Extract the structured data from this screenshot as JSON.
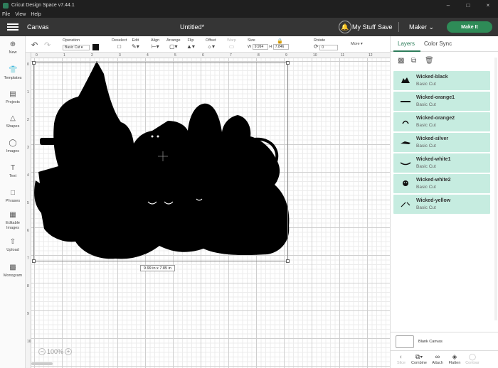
{
  "window": {
    "title": "Cricut Design Space  v7.44.1"
  },
  "menu": [
    "File",
    "View",
    "Help"
  ],
  "header": {
    "section": "Canvas",
    "doc_title": "Untitled*",
    "my_stuff": "My Stuff",
    "save": "Save",
    "machine": "Maker",
    "make_it": "Make It"
  },
  "left_tools": [
    {
      "label": "New",
      "icon": "plus-icon"
    },
    {
      "label": "Templates",
      "icon": "shirt-icon"
    },
    {
      "label": "Projects",
      "icon": "projects-icon"
    },
    {
      "label": "Shapes",
      "icon": "shapes-icon"
    },
    {
      "label": "Images",
      "icon": "bulb-icon"
    },
    {
      "label": "Text",
      "icon": "text-icon"
    },
    {
      "label": "Phrases",
      "icon": "chat-icon"
    },
    {
      "label": "Editable Images",
      "icon": "editable-images-icon"
    },
    {
      "label": "Upload",
      "icon": "upload-icon"
    },
    {
      "label": "Monogram",
      "icon": "monogram-icon"
    }
  ],
  "edit_toolbar": {
    "operation_label": "Operation",
    "operation_value": "Basic Cut",
    "deselect": "Deselect",
    "edit": "Edit",
    "align": "Align",
    "arrange": "Arrange",
    "flip": "Flip",
    "offset": "Offset",
    "warp": "Warp",
    "size_label": "Size",
    "w_label": "W",
    "w_value": "9.994",
    "h_label": "H",
    "h_value": "7.846",
    "rotate_label": "Rotate",
    "rotate_value": "0",
    "more": "More"
  },
  "canvas": {
    "ruler_top": [
      "0",
      "1",
      "2",
      "3",
      "4",
      "5",
      "6",
      "7",
      "8",
      "9",
      "10",
      "11",
      "12"
    ],
    "ruler_left": [
      "0",
      "1",
      "2",
      "3",
      "4",
      "5",
      "6",
      "7",
      "8",
      "9",
      "10"
    ],
    "size_readout": "9.99  in x 7.85  in",
    "zoom_level": "100%"
  },
  "right_panel": {
    "tab_layers": "Layers",
    "tab_color_sync": "Color Sync",
    "layers": [
      {
        "name": "Wicked-black",
        "operation": "Basic Cut"
      },
      {
        "name": "Wicked-orange1",
        "operation": "Basic Cut"
      },
      {
        "name": "Wicked-orange2",
        "operation": "Basic Cut"
      },
      {
        "name": "Wicked-silver",
        "operation": "Basic Cut"
      },
      {
        "name": "Wicked-white1",
        "operation": "Basic Cut"
      },
      {
        "name": "Wicked-white2",
        "operation": "Basic Cut"
      },
      {
        "name": "Wicked-yellow",
        "operation": "Basic Cut"
      }
    ],
    "blank_canvas": "Blank Canvas",
    "bottom_tools": [
      "Slice",
      "Combine",
      "Attach",
      "Flatten",
      "Contour"
    ]
  },
  "colors": {
    "accent": "#2e7d5b",
    "layer_bg": "#c6ece0",
    "header_bg": "#353535"
  }
}
